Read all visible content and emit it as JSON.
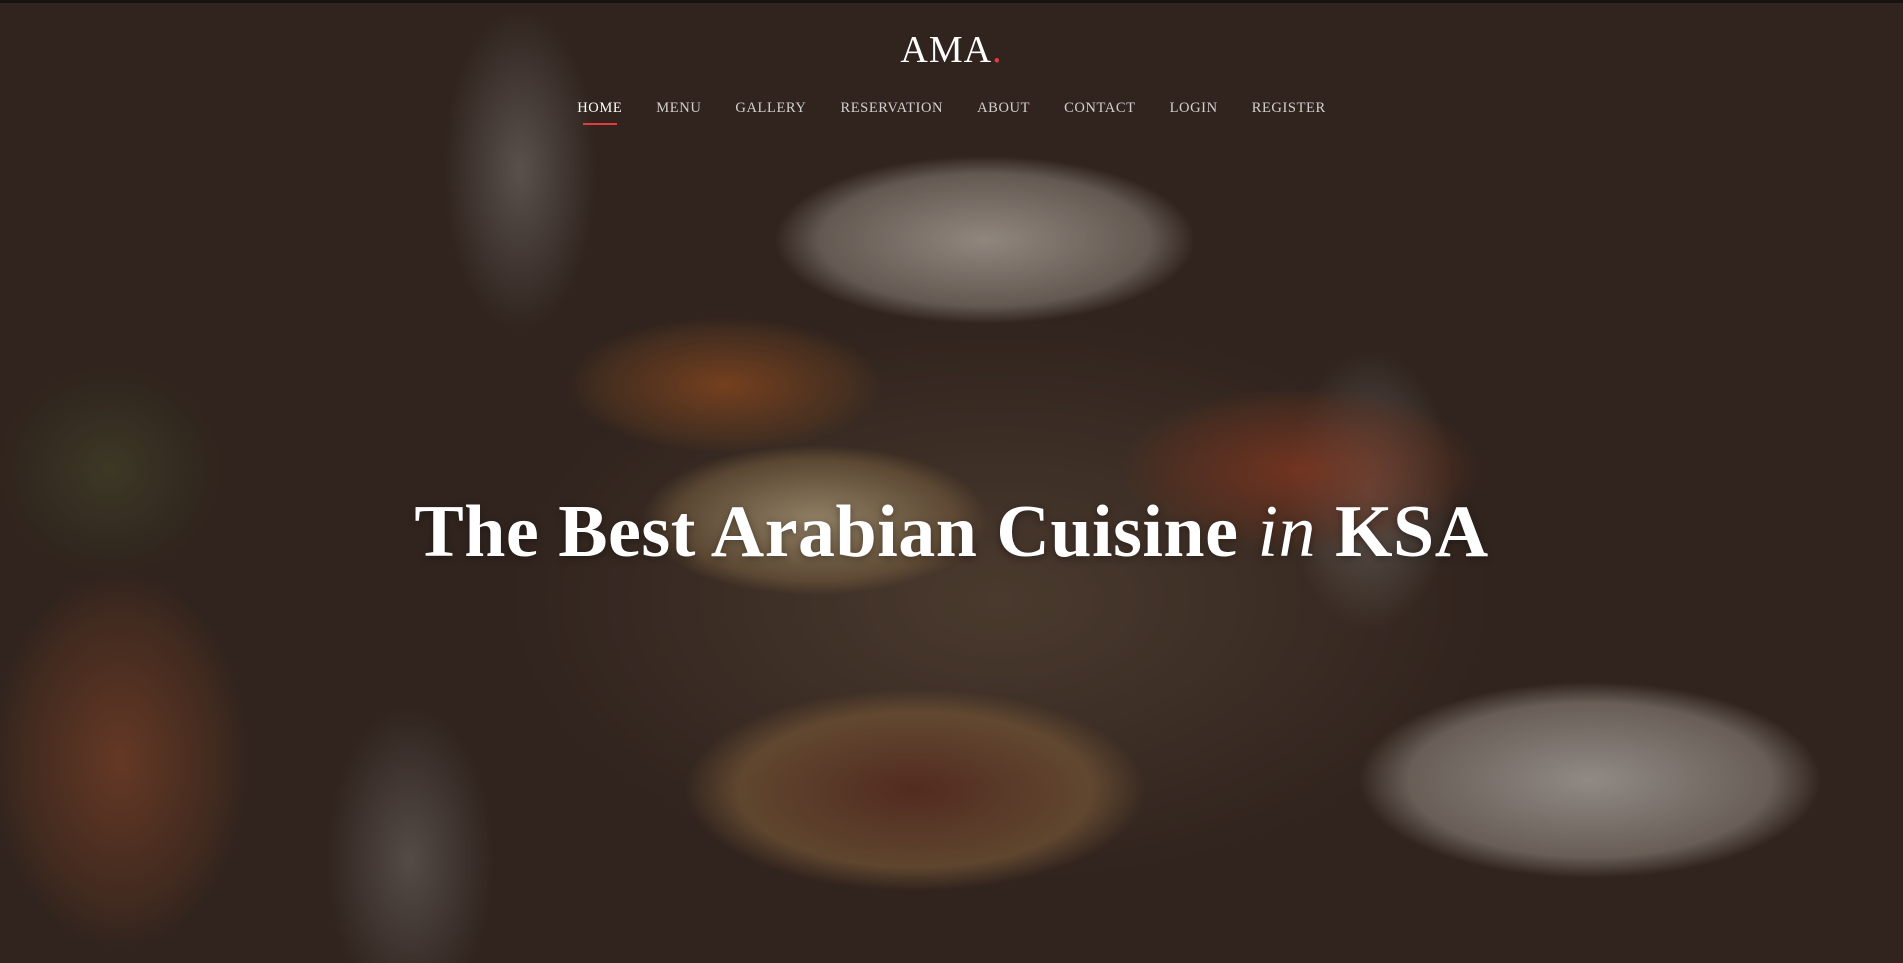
{
  "brand": {
    "name": "AMA",
    "dot": ".",
    "dot_color": "#e23b3b"
  },
  "nav": {
    "items": [
      {
        "label": "HOME",
        "active": true
      },
      {
        "label": "MENU",
        "active": false
      },
      {
        "label": "GALLERY",
        "active": false
      },
      {
        "label": "RESERVATION",
        "active": false
      },
      {
        "label": "ABOUT",
        "active": false
      },
      {
        "label": "CONTACT",
        "active": false
      },
      {
        "label": "LOGIN",
        "active": false
      },
      {
        "label": "REGISTER",
        "active": false
      }
    ]
  },
  "hero": {
    "headline_pre": "The Best Arabian Cuisine",
    "headline_italic": "in",
    "headline_post": "KSA",
    "background": "restaurant-table-arabian-dishes-photo"
  }
}
